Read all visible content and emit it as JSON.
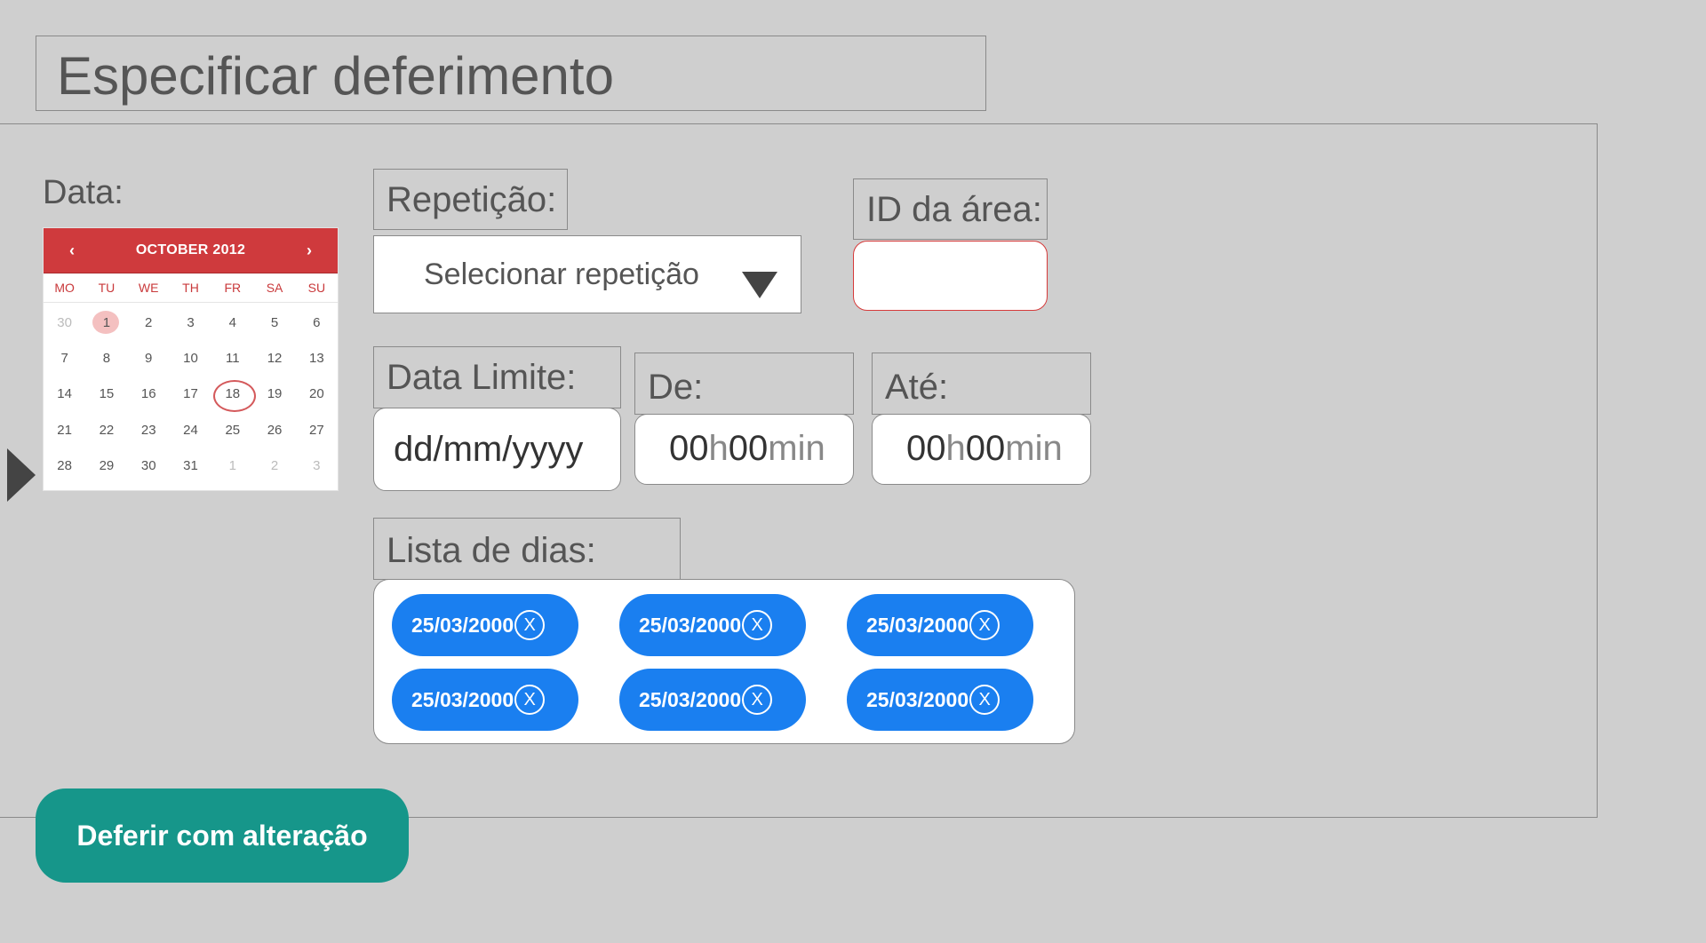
{
  "page": {
    "title": "Especificar deferimento"
  },
  "date_field": {
    "label": "Data:"
  },
  "calendar": {
    "month_title": "OCTOBER 2012",
    "prev": "‹",
    "next": "›",
    "weekdays": [
      "MO",
      "TU",
      "WE",
      "TH",
      "FR",
      "SA",
      "SU"
    ],
    "weeks": [
      [
        "30",
        "1",
        "2",
        "3",
        "4",
        "5",
        "6"
      ],
      [
        "7",
        "8",
        "9",
        "10",
        "11",
        "12",
        "13"
      ],
      [
        "14",
        "15",
        "16",
        "17",
        "18",
        "19",
        "20"
      ],
      [
        "21",
        "22",
        "23",
        "24",
        "25",
        "26",
        "27"
      ],
      [
        "28",
        "29",
        "30",
        "31",
        "1",
        "2",
        "3"
      ]
    ],
    "highlighted_day": "1",
    "circled_day": "18"
  },
  "repetition": {
    "label": "Repetição:",
    "value": "Selecionar repetição"
  },
  "area_id": {
    "label": "ID da área:",
    "value": ""
  },
  "deadline": {
    "label": "Data Limite:",
    "placeholder": "dd/mm/yyyy"
  },
  "from": {
    "label": "De:",
    "hours": "00",
    "h": "h",
    "minutes": "00",
    "min": "min"
  },
  "to": {
    "label": "Até:",
    "hours": "00",
    "h": "h",
    "minutes": "00",
    "min": "min"
  },
  "day_list": {
    "label": "Lista de dias:",
    "chips": [
      "25/03/2000",
      "25/03/2000",
      "25/03/2000",
      "25/03/2000",
      "25/03/2000",
      "25/03/2000"
    ],
    "remove_glyph": "X"
  },
  "actions": {
    "submit": "Deferir com alteração"
  },
  "colors": {
    "background": "#cfcfcf",
    "calendar_header": "#cf3a3d",
    "chip": "#1a7ff0",
    "button": "#16968a",
    "error_border": "#d63a3a"
  }
}
